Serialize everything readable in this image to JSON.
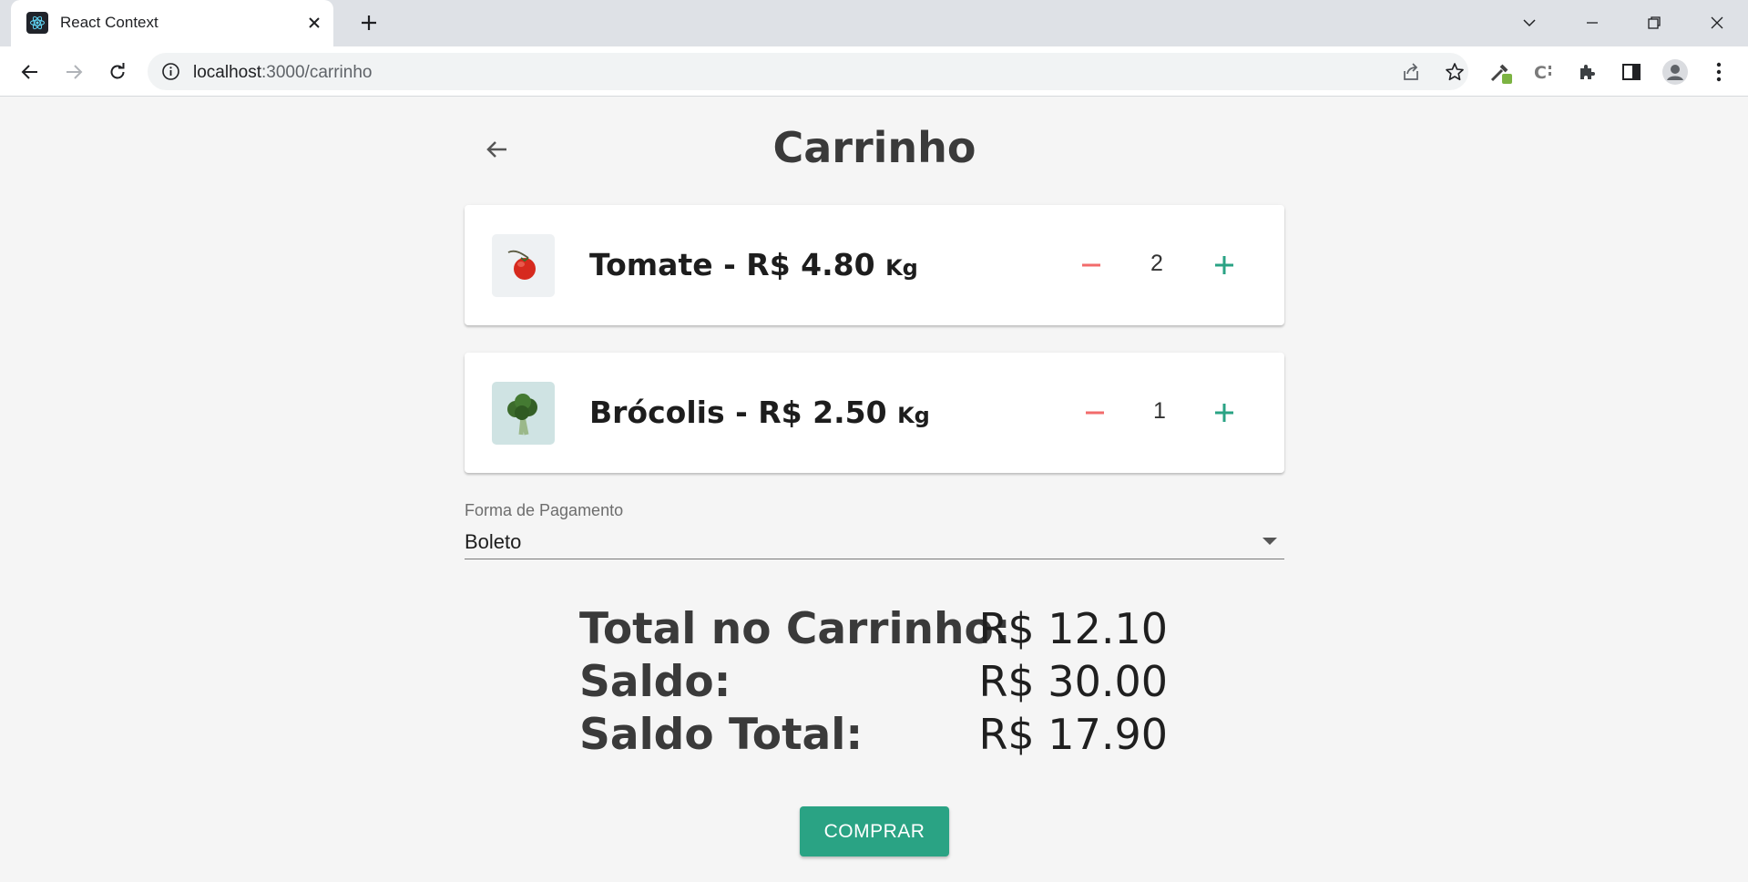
{
  "browser": {
    "tab_title": "React Context",
    "url_host": "localhost",
    "url_path": ":3000/carrinho"
  },
  "page": {
    "title": "Carrinho"
  },
  "cart": {
    "items": [
      {
        "name": "Tomate - R$ 4.80",
        "unit": "Kg",
        "quantity": "2"
      },
      {
        "name": "Brócolis - R$ 2.50",
        "unit": "Kg",
        "quantity": "1"
      }
    ]
  },
  "payment": {
    "label": "Forma de Pagamento",
    "selected": "Boleto"
  },
  "totals": {
    "cart_total_label": "Total no Carrinho:",
    "cart_total_value": "R$ 12.10",
    "balance_label": "Saldo:",
    "balance_value": "R$ 30.00",
    "final_balance_label": "Saldo Total:",
    "final_balance_value": "R$ 17.90"
  },
  "actions": {
    "buy_label": "COMPRAR"
  },
  "colors": {
    "accent": "#2aa384",
    "minus": "#f26b6b",
    "plus": "#2aa384"
  },
  "icons": [
    "react-icon",
    "close-icon",
    "plus-icon",
    "chevron-down-icon",
    "minimize-icon",
    "restore-icon",
    "back-arrow-icon",
    "forward-arrow-icon",
    "reload-icon",
    "info-icon",
    "share-icon",
    "star-icon",
    "eyedropper-extension-icon",
    "css-extension-icon",
    "puzzle-icon",
    "side-panel-icon",
    "profile-icon",
    "menu-icon",
    "minus-icon"
  ]
}
